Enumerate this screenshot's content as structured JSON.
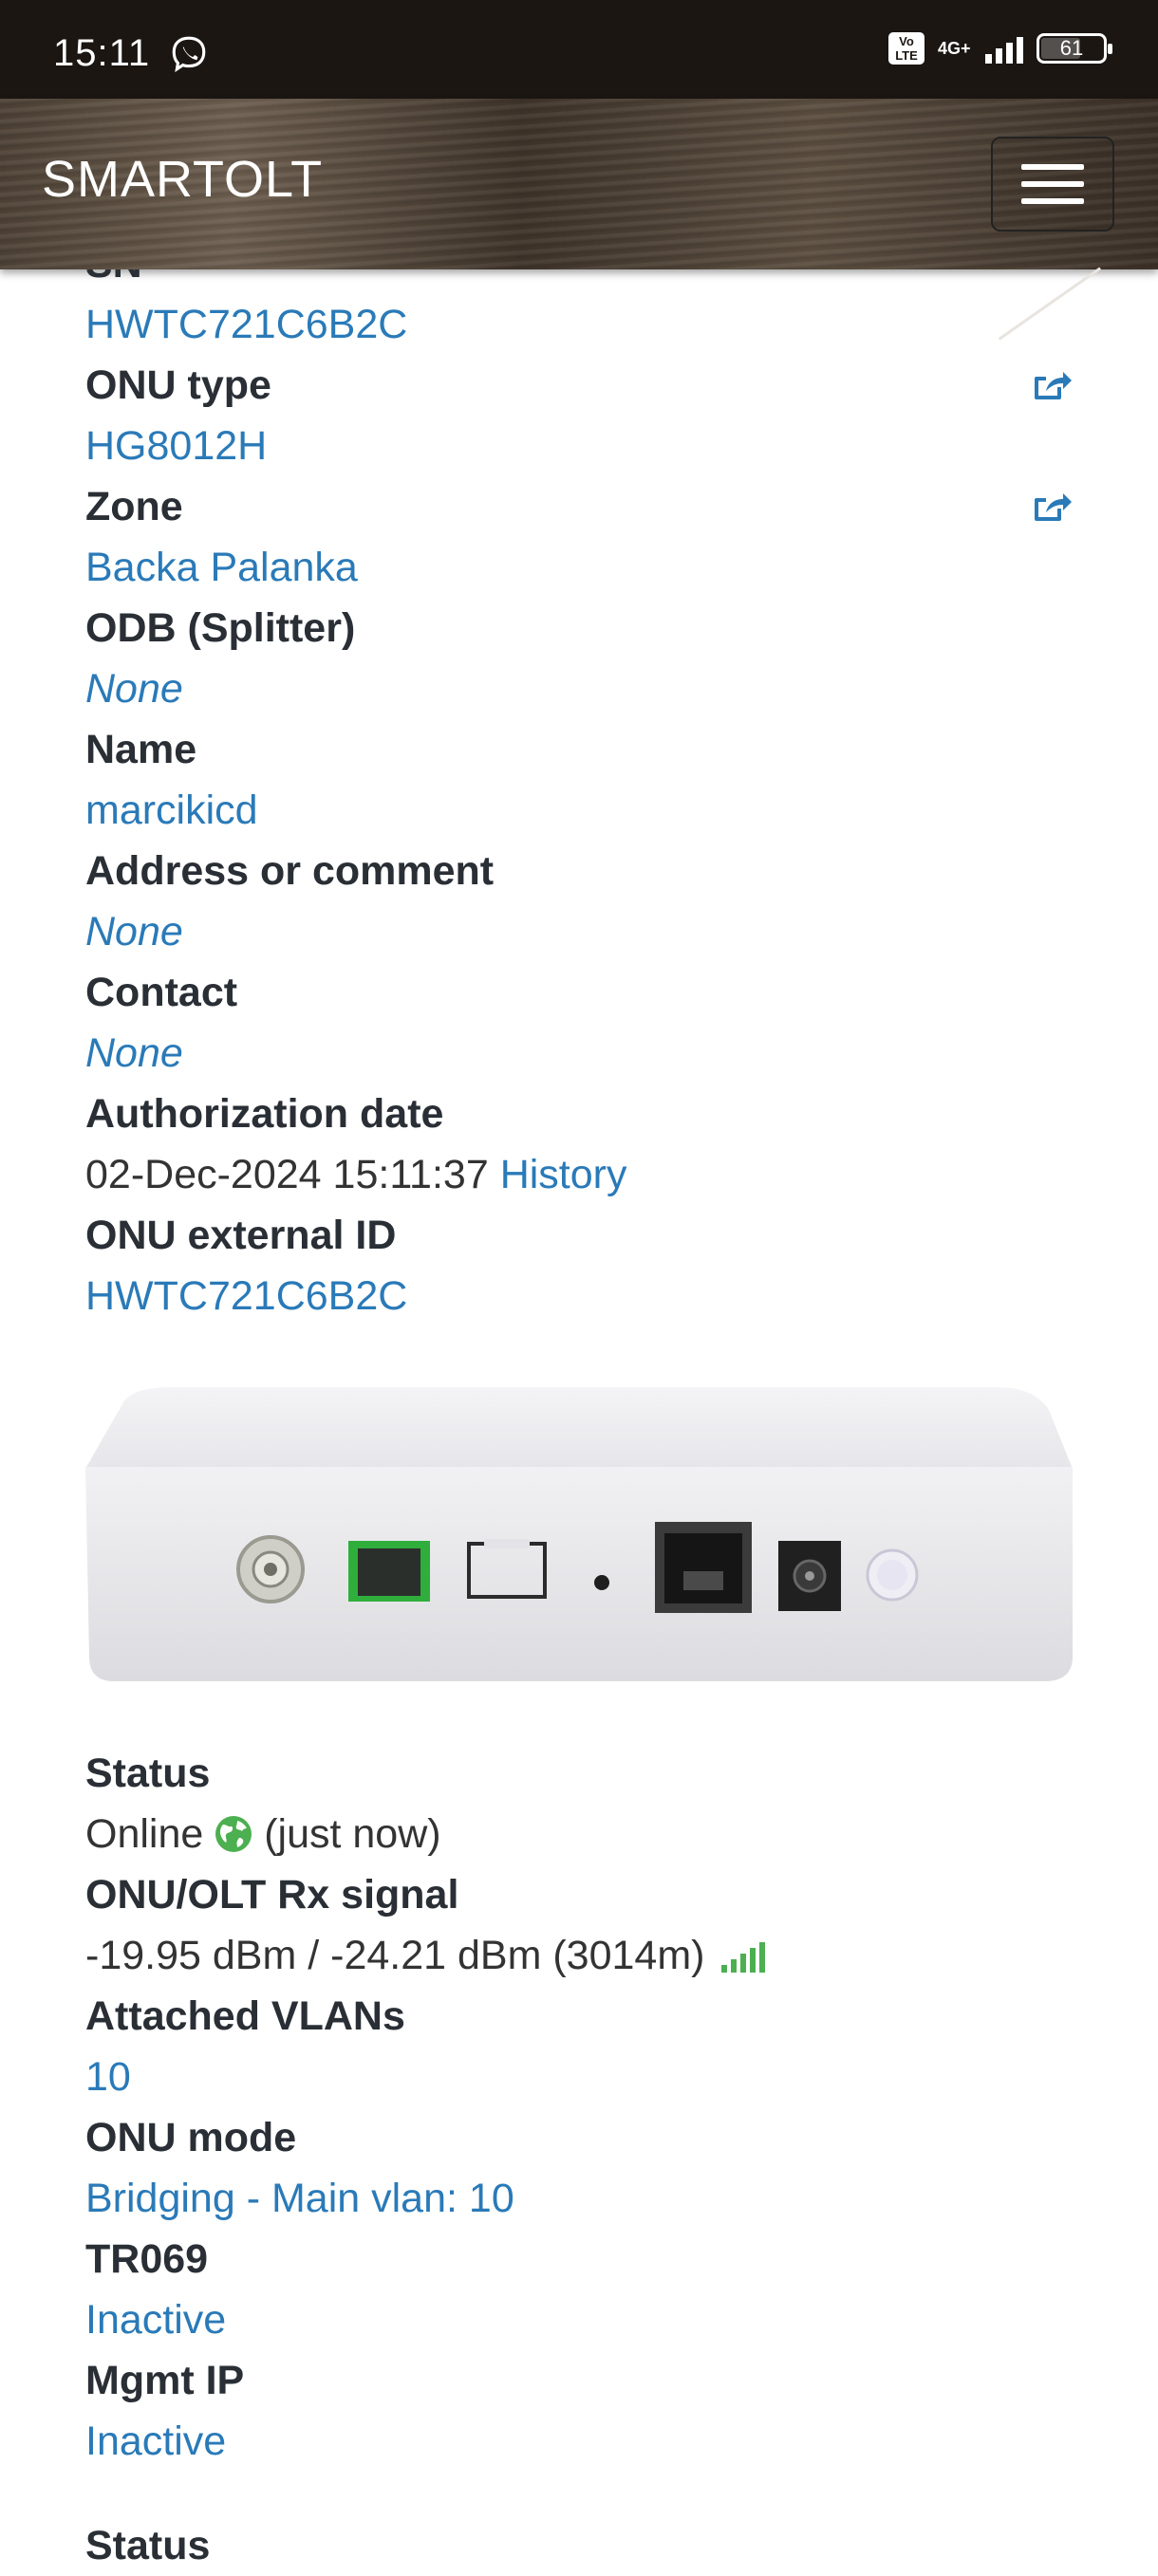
{
  "status_bar": {
    "time": "15:11",
    "volte": "Vo LTE",
    "network": "4G+",
    "battery": "61",
    "icons": [
      "viber-icon",
      "volte-icon",
      "signal-icon",
      "battery-icon"
    ]
  },
  "header": {
    "brand": "SMARTOLT",
    "menu_icon": "hamburger-menu-icon"
  },
  "details": {
    "sn": {
      "label": "SN",
      "value": "HWTC721C6B2C"
    },
    "onu_type": {
      "label": "ONU type",
      "value": "HG8012H",
      "action_icon": "external-link-icon"
    },
    "zone": {
      "label": "Zone",
      "value": "Backa Palanka",
      "action_icon": "external-link-icon"
    },
    "odb": {
      "label": "ODB (Splitter)",
      "value": "None"
    },
    "name": {
      "label": "Name",
      "value": "marcikicd"
    },
    "address": {
      "label": "Address or comment",
      "value": "None"
    },
    "contact": {
      "label": "Contact",
      "value": "None"
    },
    "auth_date": {
      "label": "Authorization date",
      "value": "02-Dec-2024 15:11:37",
      "link": "History"
    },
    "external_id": {
      "label": "ONU external ID",
      "value": "HWTC721C6B2C"
    }
  },
  "status": {
    "status": {
      "label": "Status",
      "value": "Online",
      "suffix": "(just now)",
      "icon": "globe-icon"
    },
    "rx_signal": {
      "label": "ONU/OLT Rx signal",
      "value": "-19.95 dBm / -24.21 dBm (3014m)",
      "icon": "signal-strength-icon"
    },
    "vlans": {
      "label": "Attached VLANs",
      "value": "10"
    },
    "onu_mode": {
      "label": "ONU mode",
      "value": "Bridging - Main vlan: 10"
    },
    "tr069": {
      "label": "TR069",
      "value": "Inactive"
    },
    "mgmt_ip": {
      "label": "Mgmt IP",
      "value": "Inactive"
    }
  },
  "next_section": {
    "label": "Status"
  },
  "colors": {
    "label": "#2a2f36",
    "link": "#2a7ab8",
    "signal_green": "#4caf50"
  }
}
